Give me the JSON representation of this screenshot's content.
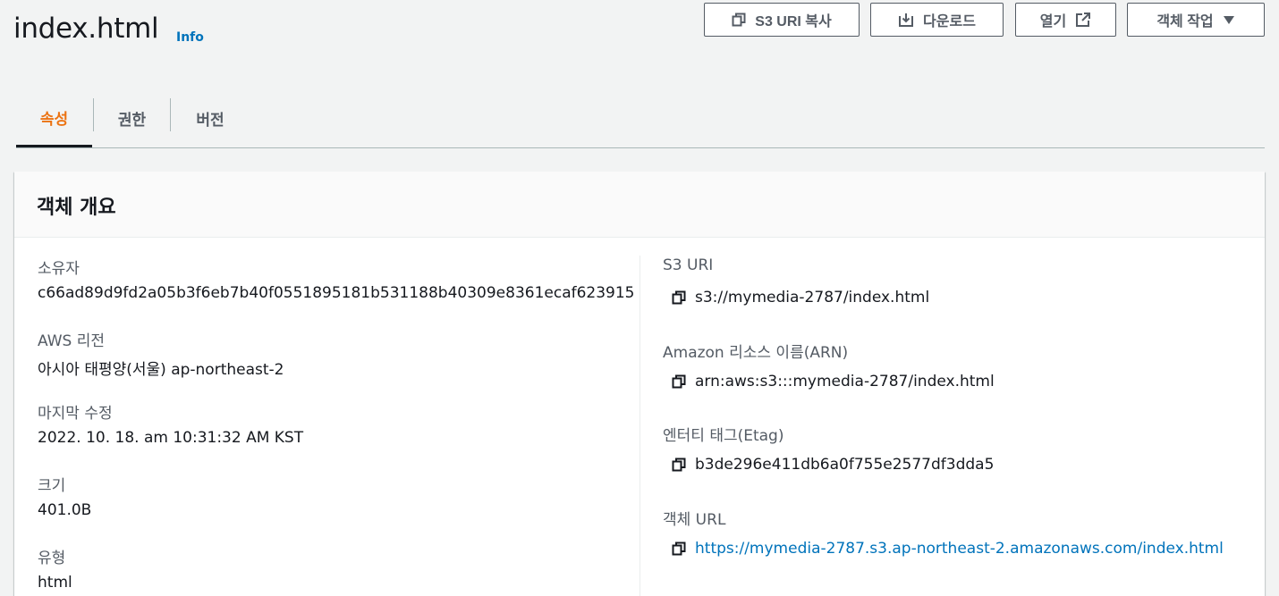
{
  "header": {
    "title": "index.html",
    "info": "Info",
    "buttons": {
      "copy_uri": "S3 URI 복사",
      "download": "다운로드",
      "open": "열기",
      "actions": "객체 작업"
    }
  },
  "tabs": [
    {
      "label": "속성",
      "active": true
    },
    {
      "label": "권한",
      "active": false
    },
    {
      "label": "버전",
      "active": false
    }
  ],
  "overview": {
    "title": "객체 개요",
    "left": {
      "owner_label": "소유자",
      "owner_value": "c66ad89d9fd2a05b3f6eb7b40f0551895181b531188b40309e8361ecaf623915",
      "region_label": "AWS 리전",
      "region_value": "아시아 태평양(서울) ap-northeast-2",
      "modified_label": "마지막 수정",
      "modified_value": "2022. 10. 18. am 10:31:32 AM KST",
      "size_label": "크기",
      "size_value": "401.0B",
      "type_label": "유형",
      "type_value": "html"
    },
    "right": {
      "s3uri_label": "S3 URI",
      "s3uri_value": "s3://mymedia-2787/index.html",
      "arn_label": "Amazon 리소스 이름(ARN)",
      "arn_value": "arn:aws:s3:::mymedia-2787/index.html",
      "etag_label": "엔터티 태그(Etag)",
      "etag_value": "b3de296e411db6a0f755e2577df3dda5",
      "url_label": "객체 URL",
      "url_value": "https://mymedia-2787.s3.ap-northeast-2.amazonaws.com/index.html"
    }
  },
  "colors": {
    "accent_tab": "#ec7211",
    "link": "#0073bb",
    "text": "#16191f",
    "secondary": "#545b64"
  },
  "icons": {
    "copy": "copy-icon",
    "download": "download-icon",
    "external": "external-link-icon",
    "caret": "caret-down-icon"
  }
}
